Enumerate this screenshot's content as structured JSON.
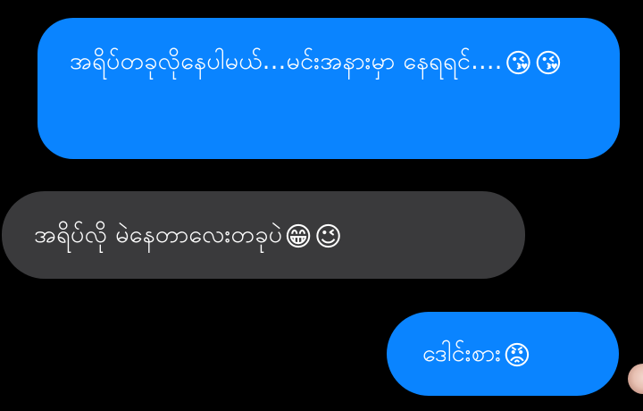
{
  "colors": {
    "background": "#000000",
    "sent_bubble": "#0a84ff",
    "received_bubble": "#3a3a3c",
    "text": "#ffffff"
  },
  "messages": [
    {
      "direction": "sent",
      "text": "အရိပ်တခုလိုနေပါမယ်...မင်းအနားမှာ နေရရင်....",
      "emojis": [
        "😘",
        "😘"
      ],
      "emoji_names": [
        "face-blowing-kiss-icon",
        "face-blowing-kiss-icon"
      ]
    },
    {
      "direction": "received",
      "text": "အရိပ်လို မဲနေတာလေးတခုပဲ",
      "emojis": [
        "😁",
        "😉"
      ],
      "emoji_names": [
        "grinning-face-icon",
        "winking-face-icon"
      ]
    },
    {
      "direction": "sent",
      "text": "ဒေါင်းစား",
      "emojis": [
        "😡"
      ],
      "emoji_names": [
        "angry-face-icon"
      ]
    }
  ],
  "read_receipt": {
    "icon": "avatar-icon"
  }
}
